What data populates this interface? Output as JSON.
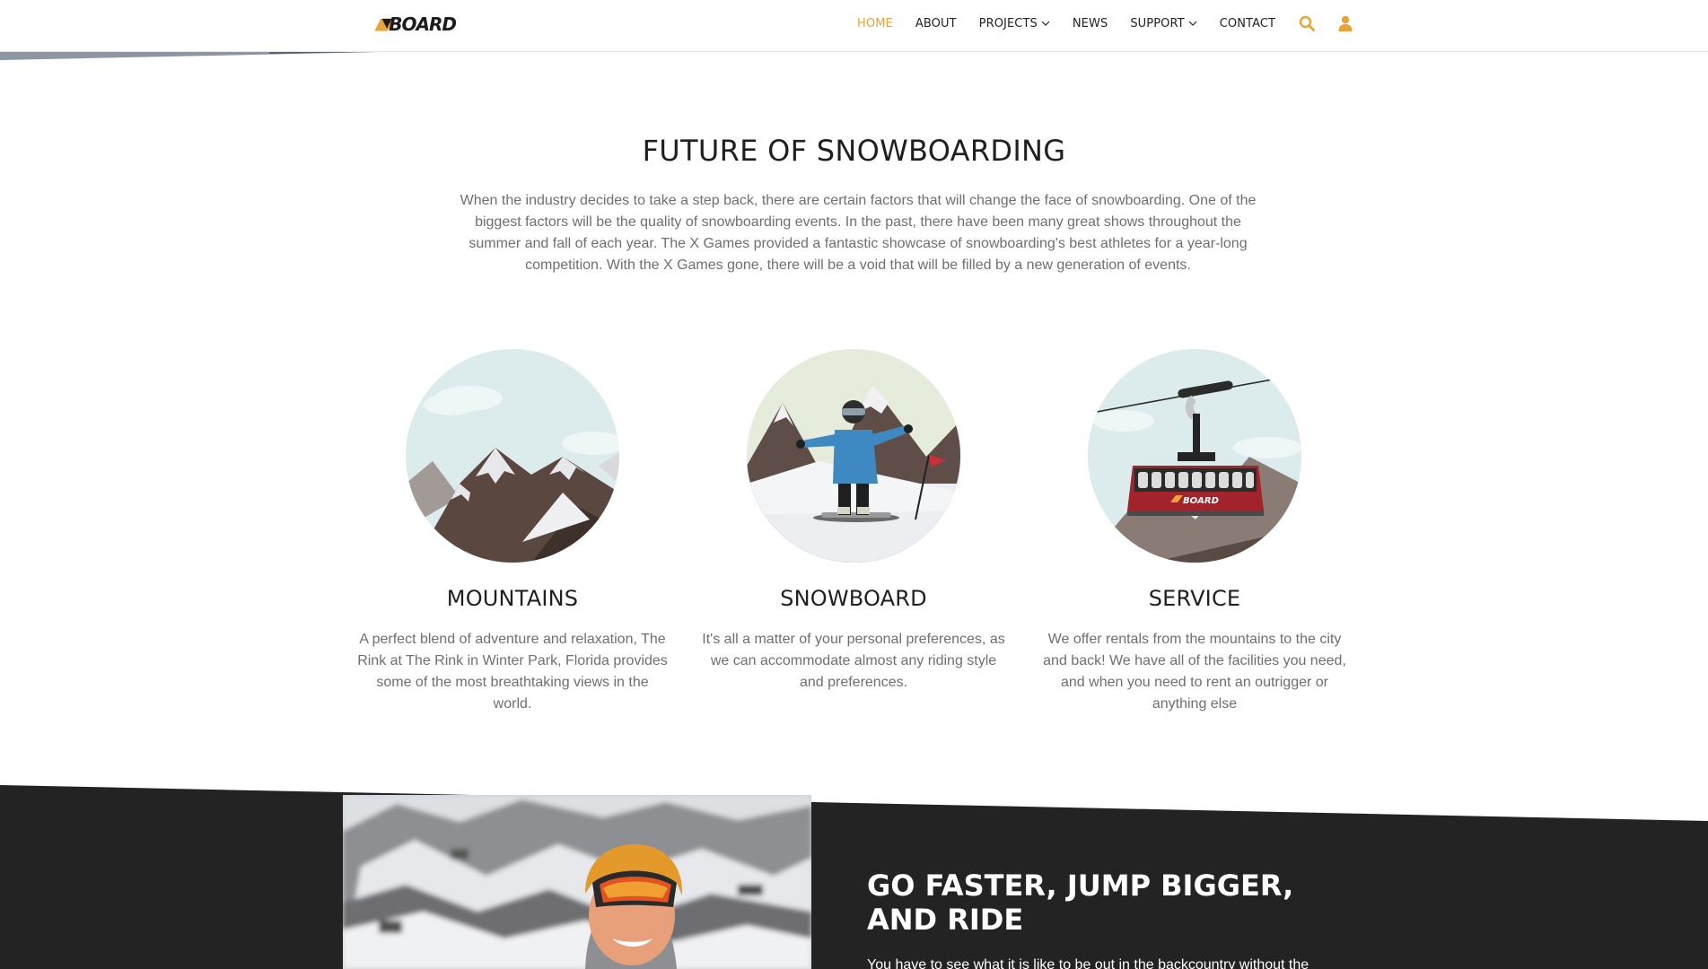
{
  "header": {
    "logo_text": "BOARD",
    "nav": [
      {
        "label": "HOME",
        "active": true
      },
      {
        "label": "ABOUT"
      },
      {
        "label": "PROJECTS",
        "dropdown": true
      },
      {
        "label": "NEWS"
      },
      {
        "label": "SUPPORT",
        "dropdown": true
      },
      {
        "label": "CONTACT"
      }
    ],
    "icons": [
      "search-icon",
      "user-icon"
    ]
  },
  "intro": {
    "title": "FUTURE OF SNOWBOARDING",
    "text": "When the industry decides to take a step back, there are certain factors that will change the face of snowboarding. One of the biggest factors will be the quality of snowboarding events. In the past, there have been many great shows throughout the summer and fall of each year. The X Games provided a fantastic showcase of snowboarding's best athletes for a year-long competition. With the X Games gone, there will be a void that will be filled by a new generation of events."
  },
  "features": [
    {
      "title": "MOUNTAINS",
      "text": "A perfect blend of adventure and relaxation, The Rink at The Rink in Winter Park, Florida provides some of the most breathtaking views in the world."
    },
    {
      "title": "SNOWBOARD",
      "text": "It's all a matter of your personal preferences, as we can accommodate almost any riding style and preferences."
    },
    {
      "title": "SERVICE",
      "text": "We offer rentals from the mountains to the city and back! We have all of the facilities you need, and when you need to rent an outrigger or anything else"
    }
  ],
  "promo": {
    "title": "GO FASTER, JUMP BIGGER, AND RIDE",
    "text": "You have to see what it is like to be out in the backcountry without the"
  },
  "gondola_logo_text": "BOARD",
  "colors": {
    "accent": "#e8a33a",
    "dark_bg": "#222222",
    "text_gray": "#6f6f6f",
    "heading": "#1f1f1f"
  }
}
